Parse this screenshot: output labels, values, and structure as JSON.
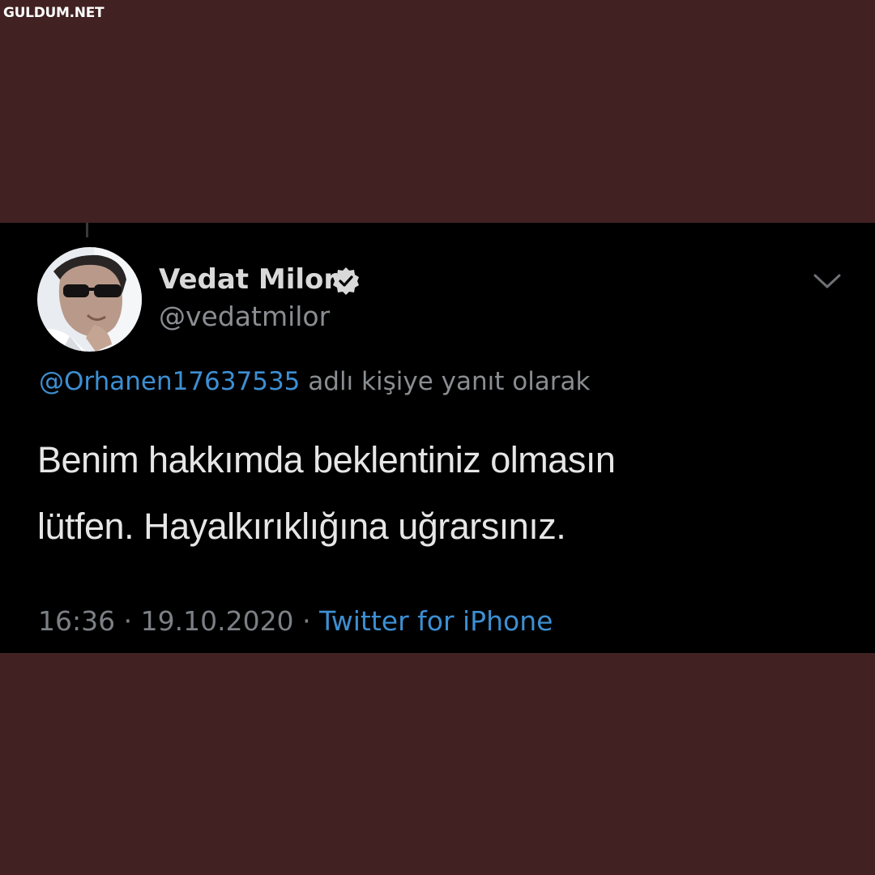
{
  "watermark": "GULDUM.NET",
  "tweet": {
    "display_name": "Vedat Milor",
    "handle": "@vedatmilor",
    "reply_to": "@Orhanen17637535",
    "reply_suffix": "adlı kişiye yanıt olarak",
    "text_line_1": "Benim hakkımda beklentiniz olmasın",
    "text_line_2": "lütfen. Hayalkırıklığına uğrarsınız.",
    "time": "16:36",
    "separator": "·",
    "date": "19.10.2020",
    "source": "Twitter for iPhone"
  },
  "icons": {
    "verified": "verified-badge-icon",
    "menu": "chevron-down-icon"
  },
  "colors": {
    "background": "#412121",
    "tweet_background": "#000000",
    "link": "#3d8fd2",
    "muted": "#8a8d91"
  }
}
